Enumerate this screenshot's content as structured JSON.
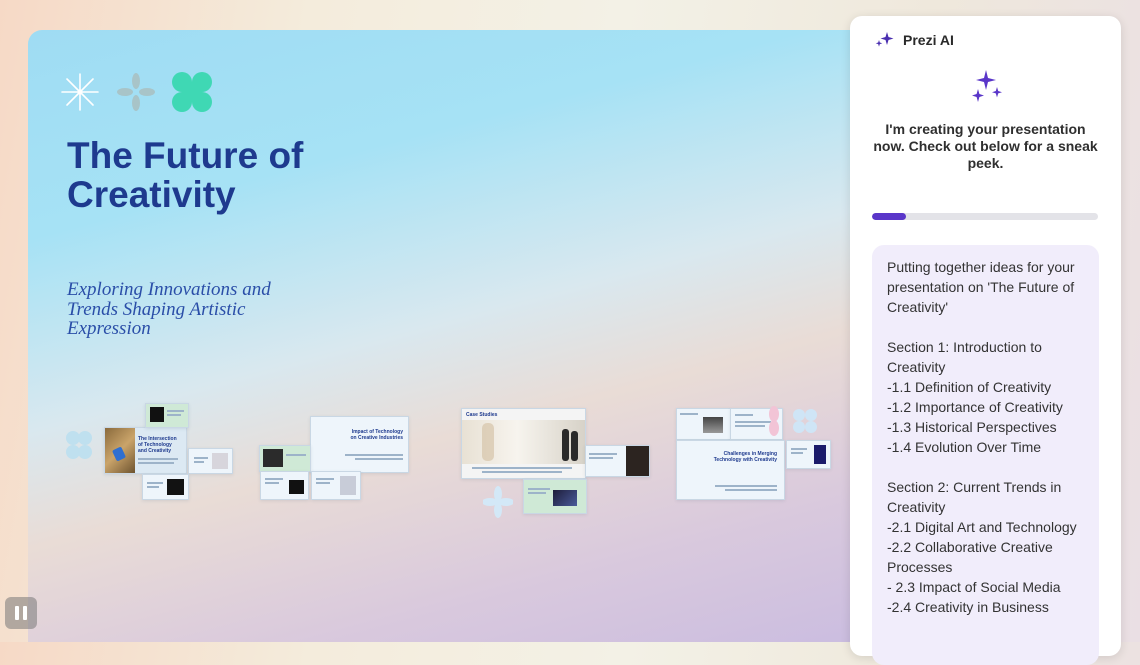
{
  "presentation": {
    "title": "The Future of Creativity",
    "subtitle": "Exploring Innovations and Trends Shaping Artistic Expression",
    "thumbnails": [
      {
        "title": "The Intersection of Technology and Creativity"
      },
      {
        "title": "Impact of Technology on Creative Industries"
      },
      {
        "title": "Case Studies"
      },
      {
        "title": "Challenges in Merging Technology with Creativity"
      }
    ]
  },
  "panel": {
    "title": "Prezi AI",
    "message": "I'm creating your presentation now. Check out below for a sneak peek.",
    "progress_percent": 15,
    "ideas_lines": [
      "Putting together ideas for your presentation on 'The Future of Creativity'",
      "",
      "Section 1: Introduction to Creativity",
      "-1.1 Definition of Creativity",
      "-1.2 Importance of Creativity",
      "-1.3 Historical Perspectives",
      "-1.4 Evolution Over Time",
      "",
      "Section 2: Current Trends in Creativity",
      "-2.1 Digital Art and Technology",
      "-2.2 Collaborative Creative Processes",
      "- 2.3 Impact of Social Media",
      "-2.4 Creativity in Business"
    ]
  },
  "colors": {
    "accent": "#5a36c9",
    "title_blue": "#1e3a8e",
    "mint": "#3fd8b4"
  },
  "icons": {
    "pause": "pause-icon",
    "sparkle": "sparkle-icon"
  }
}
